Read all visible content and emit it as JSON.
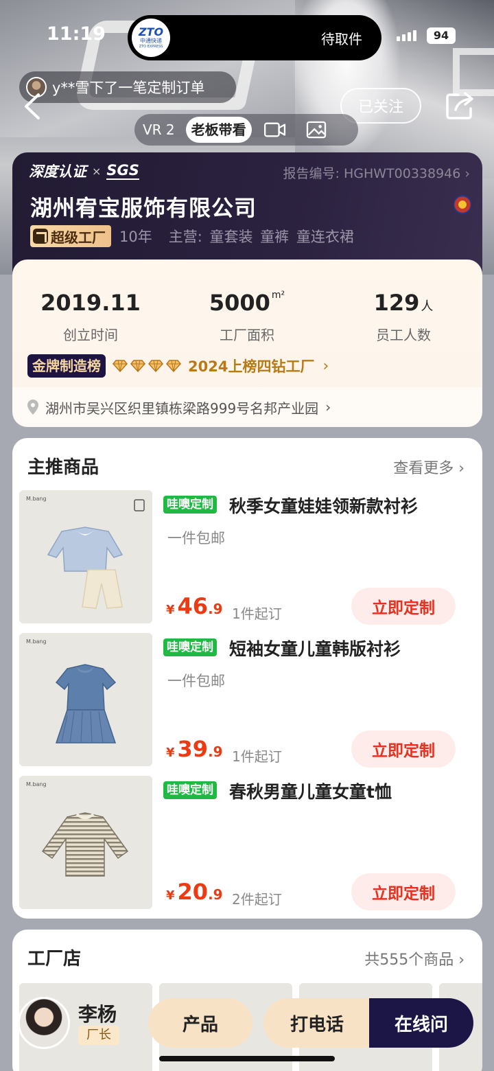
{
  "status_bar": {
    "time": "11:19",
    "island_text": "待取件",
    "island_logo": "中通快递",
    "island_logo_sub": "ZTO EXPRESS",
    "island_logo_mark": "ZTO",
    "battery": "94"
  },
  "hero": {
    "order_ticker": "y**雪下了一笔定制订单",
    "follow_label": "已关注",
    "media_tabs": [
      {
        "label": "VR 2",
        "active": false
      },
      {
        "label": "老板带看",
        "active": true
      }
    ],
    "media_icons": [
      "video-icon",
      "image-icon"
    ]
  },
  "company": {
    "cert_1": "深度认证",
    "cert_sep": "×",
    "cert_2": "SGS",
    "report_no": "报告编号: HGHWT00338946 ›",
    "name": "湖州宥宝服饰有限公司",
    "super_badge": "超级工厂",
    "years": "10年",
    "main_label": "主营:",
    "main_items": [
      "童套装",
      "童裤",
      "童连衣裙"
    ],
    "stats": [
      {
        "value": "2019.11",
        "unit": "",
        "label": "创立时间"
      },
      {
        "value": "5000",
        "unit": "m²",
        "label": "工厂面积"
      },
      {
        "value": "129",
        "unit": "人",
        "label": "员工人数"
      }
    ],
    "gold_badge": "金牌制造榜",
    "diamond_count": 4,
    "rank_text": "2024上榜四钻工厂",
    "address": "湖州市吴兴区织里镇栋梁路999号名邦产业园"
  },
  "recommended": {
    "title": "主推商品",
    "more": "查看更多 ›",
    "products": [
      {
        "tag": "哇噢定制",
        "title": "秋季女童娃娃领新款衬衫",
        "ship": "一件包邮",
        "yen": "¥",
        "price_int": "46",
        "price_dec": ".9",
        "moq": "1件起订",
        "button": "立即定制",
        "brand": "M.bang"
      },
      {
        "tag": "哇噢定制",
        "title": "短袖女童儿童韩版衬衫",
        "ship": "一件包邮",
        "yen": "¥",
        "price_int": "39",
        "price_dec": ".9",
        "moq": "1件起订",
        "button": "立即定制",
        "brand": "M.bang"
      },
      {
        "tag": "哇噢定制",
        "title": "春秋男童儿童女童t恤",
        "ship": "",
        "yen": "¥",
        "price_int": "20",
        "price_dec": ".9",
        "moq": "2件起订",
        "button": "立即定制",
        "brand": "M.bang"
      }
    ]
  },
  "shop": {
    "title": "工厂店",
    "count": "共555个商品 ›"
  },
  "bottom_bar": {
    "name": "李杨",
    "role": "厂长",
    "product_btn": "产品",
    "call_btn": "打电话",
    "online_btn": "在线问"
  }
}
